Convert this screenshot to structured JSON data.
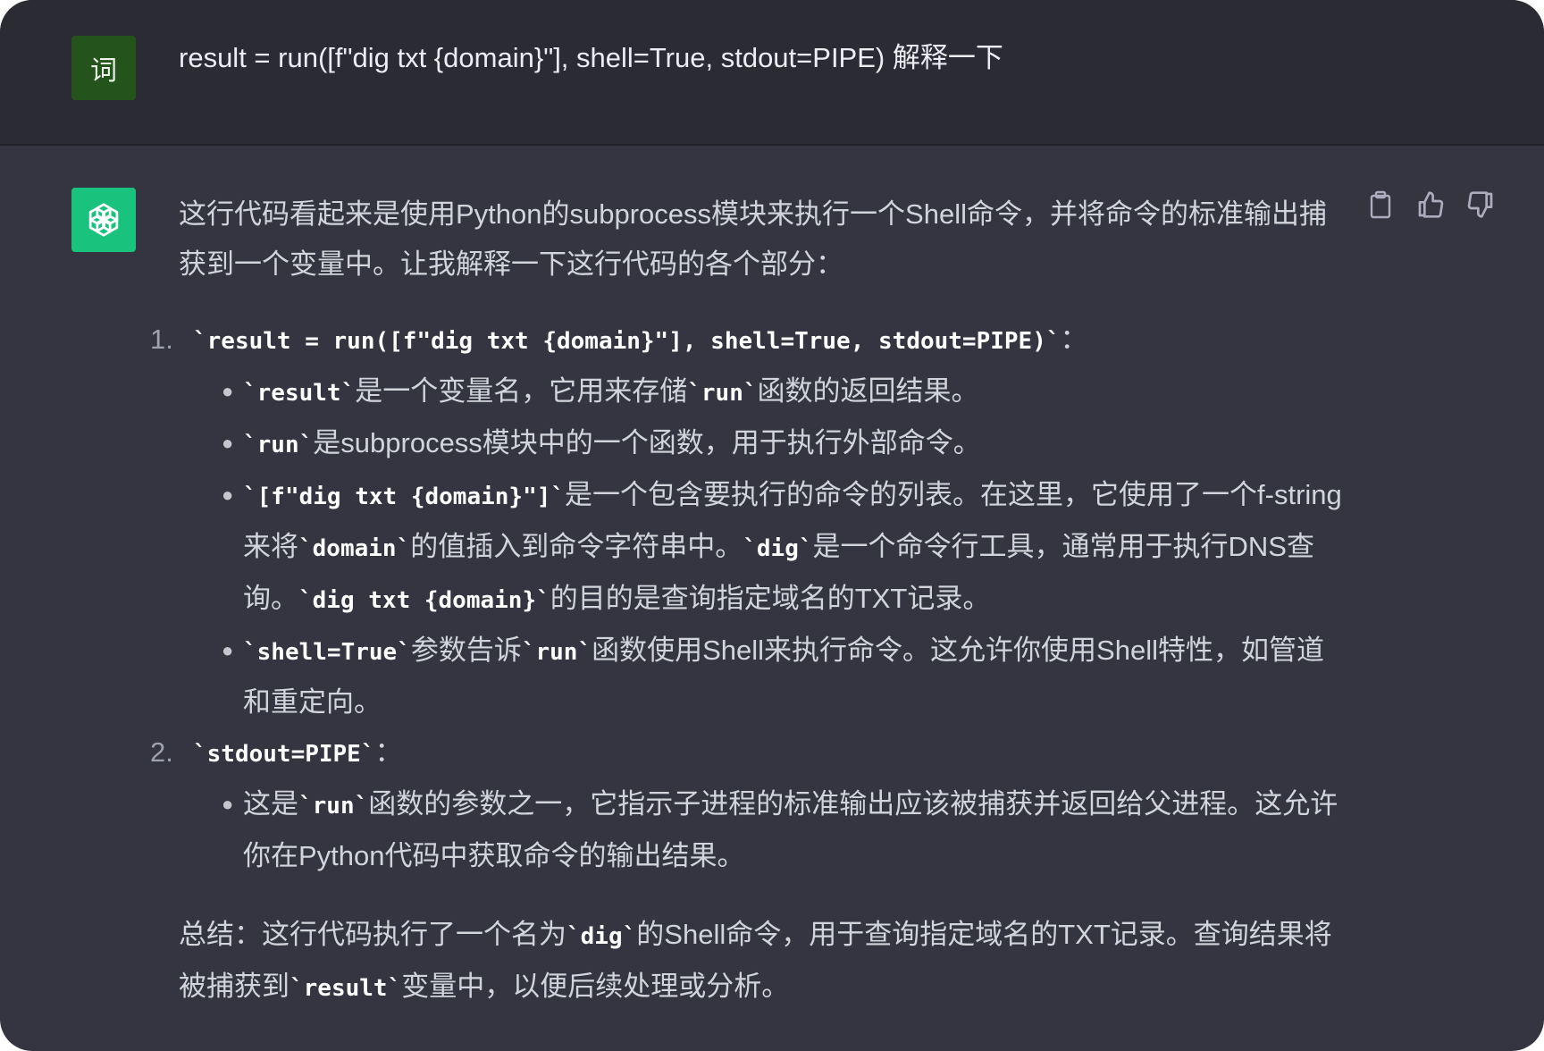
{
  "user": {
    "avatar_label": "词",
    "message": "result = run([f\"dig txt {domain}\"], shell=True, stdout=PIPE) 解释一下"
  },
  "assistant": {
    "intro": "这行代码看起来是使用Python的subprocess模块来执行一个Shell命令，并将命令的标准输出捕获到一个变量中。让我解释一下这行代码的各个部分：",
    "items": [
      {
        "number": "1.",
        "code": "`result = run([f\"dig txt {domain}\"], shell=True, stdout=PIPE)`",
        "suffix": "：",
        "bullets": [
          {
            "c1": "`result`",
            "t1": "是一个变量名，它用来存储",
            "c2": "`run`",
            "t2": "函数的返回结果。"
          },
          {
            "c1": "`run`",
            "t1": "是subprocess模块中的一个函数，用于执行外部命令。"
          },
          {
            "c1": "`[f\"dig txt {domain}\"]`",
            "t1": "是一个包含要执行的命令的列表。在这里，它使用了一个f-string来将",
            "c2": "`domain`",
            "t2": "的值插入到命令字符串中。",
            "c3": "`dig`",
            "t3": "是一个命令行工具，通常用于执行DNS查询。",
            "c4": "`dig txt {domain}`",
            "t4": "的目的是查询指定域名的TXT记录。"
          },
          {
            "c1": "`shell=True`",
            "t1": "参数告诉",
            "c2": "`run`",
            "t2": "函数使用Shell来执行命令。这允许你使用Shell特性，如管道和重定向。"
          }
        ]
      },
      {
        "number": "2.",
        "code": "`stdout=PIPE`",
        "suffix": "：",
        "bullets": [
          {
            "t0": "这是",
            "c1": "`run`",
            "t1": "函数的参数之一，它指示子进程的标准输出应该被捕获并返回给父进程。这允许你在Python代码中获取命令的输出结果。"
          }
        ]
      }
    ],
    "summary": {
      "t0": "总结：这行代码执行了一个名为",
      "c1": "`dig`",
      "t1": "的Shell命令，用于查询指定域名的TXT记录。查询结果将被捕获到",
      "c2": "`result`",
      "t2": "变量中，以便后续处理或分析。"
    }
  },
  "actions": [
    "copy-icon",
    "thumbs-up-icon",
    "thumbs-down-icon"
  ],
  "colors": {
    "user_row_bg": "#2a2b33",
    "assistant_bg": "#343541",
    "bot_avatar": "#19c37d",
    "user_avatar": "#24541c"
  }
}
